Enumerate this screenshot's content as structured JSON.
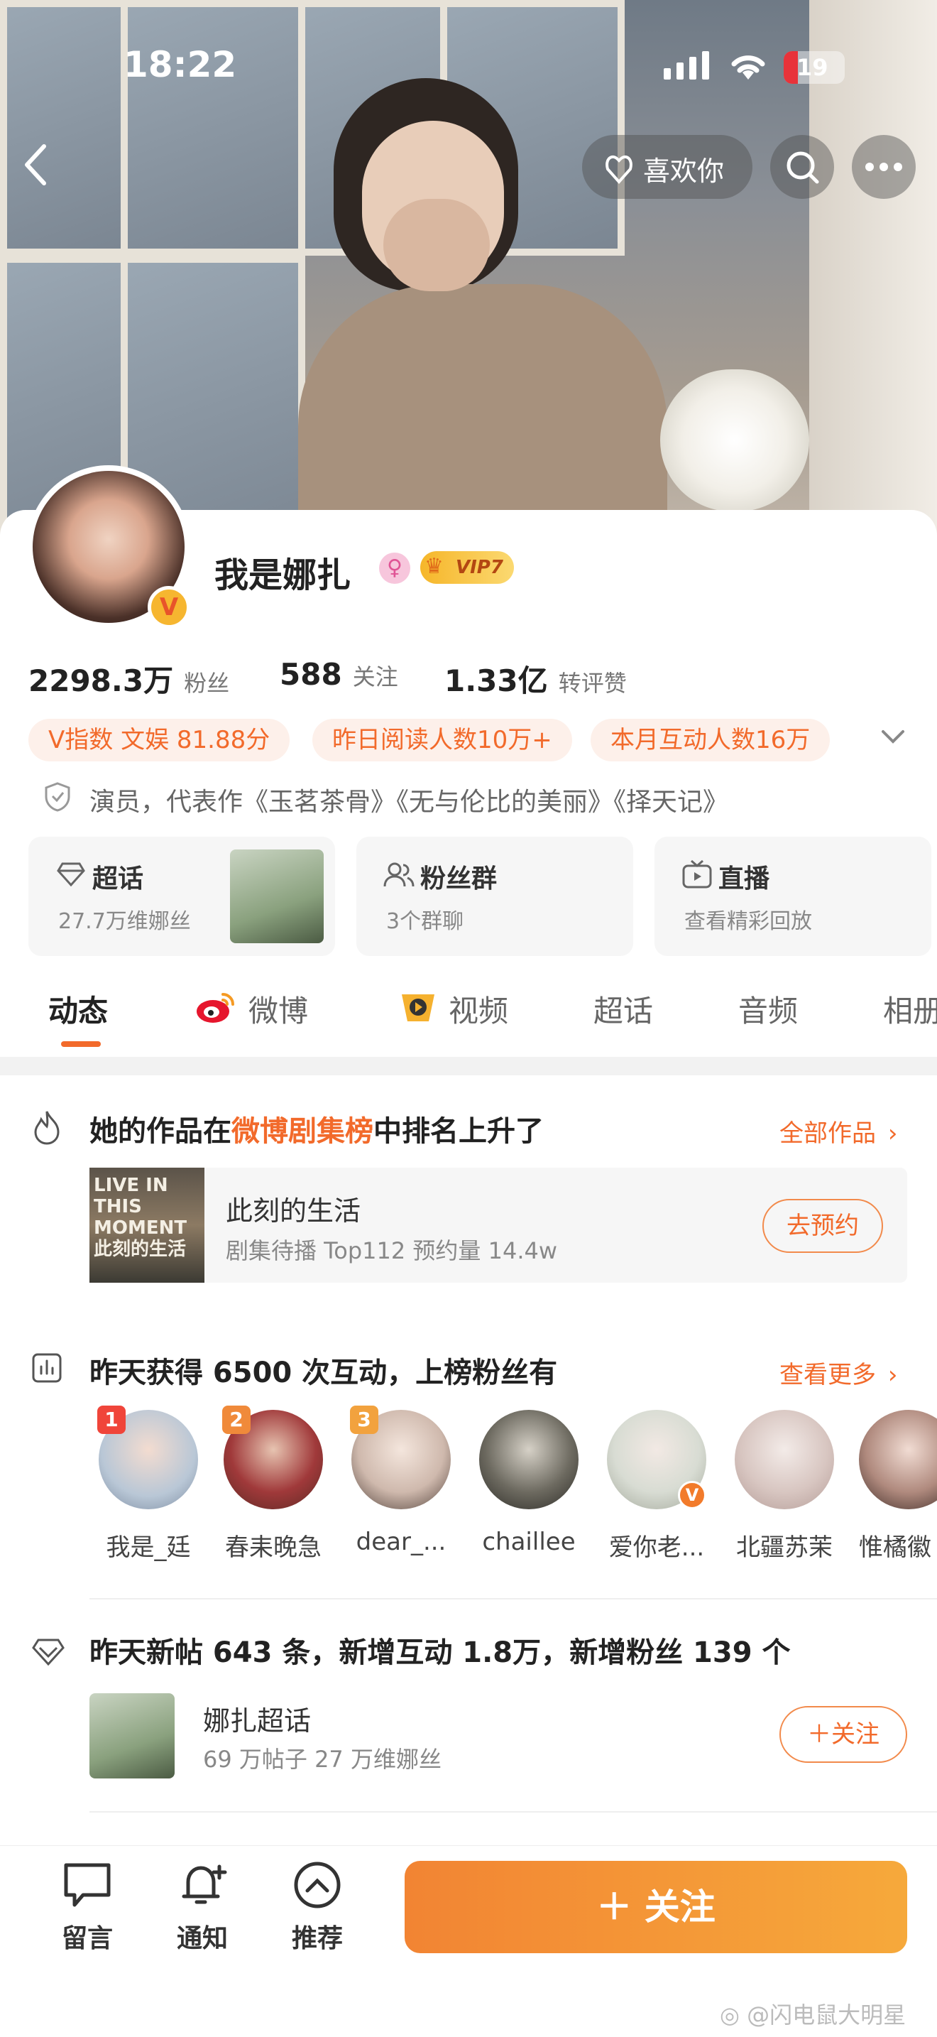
{
  "status_bar": {
    "time": "18:22",
    "battery": "19"
  },
  "top_nav": {
    "like_label": "喜欢你"
  },
  "profile": {
    "name": "我是娜扎",
    "vip_label": "VIP7",
    "stats": [
      {
        "value": "2298.3万",
        "label": "粉丝"
      },
      {
        "value": "588",
        "label": "关注"
      },
      {
        "value": "1.33亿",
        "label": "转评赞"
      }
    ],
    "chips": [
      "V指数 文娱 81.88分",
      "昨日阅读人数10万+",
      "本月互动人数16万"
    ],
    "verified_text": "演员，代表作《玉茗茶骨》《无与伦比的美丽》《择天记》"
  },
  "feature_cards": [
    {
      "title": "超话",
      "sub": "27.7万维娜丝"
    },
    {
      "title": "粉丝群",
      "sub": "3个群聊"
    },
    {
      "title": "直播",
      "sub": "查看精彩回放"
    }
  ],
  "tabs": [
    "动态",
    "微博",
    "视频",
    "超话",
    "音频",
    "相册"
  ],
  "works_section": {
    "title_prefix": "她的作品在",
    "title_highlight": "微博剧集榜",
    "title_suffix": "中排名上升了",
    "link": "全部作品",
    "item_title": "此刻的生活",
    "item_sub": "剧集待播 Top112 预约量 14.4w",
    "item_button": "去预约",
    "poster_text": "LIVE IN THIS MOMENT 此刻的生活"
  },
  "interaction_section": {
    "title": "昨天获得 6500 次互动，上榜粉丝有",
    "link": "查看更多",
    "fans": [
      {
        "rank": "1",
        "name": "我是_廷"
      },
      {
        "rank": "2",
        "name": "春耒晚急"
      },
      {
        "rank": "3",
        "name": "dear_..."
      },
      {
        "rank": "",
        "name": "chaillee"
      },
      {
        "rank": "",
        "name": "爱你老..."
      },
      {
        "rank": "",
        "name": "北疆苏茉"
      },
      {
        "rank": "",
        "name": "惟橘徽"
      }
    ]
  },
  "supertopic_section": {
    "title": "昨天新帖 643 条，新增互动 1.8万，新增粉丝 139 个",
    "item_title": "娜扎超话",
    "item_sub": "69 万帖子 27 万维娜丝",
    "follow_button": "＋关注"
  },
  "bottom_bar": {
    "actions": [
      "留言",
      "通知",
      "推荐"
    ],
    "follow_button": "＋ 关注"
  },
  "watermark": "@闪电鼠大明星",
  "colors": {
    "accent": "#f26a2b",
    "follow_gradient_start": "#f28433",
    "follow_gradient_end": "#f6a93b"
  }
}
